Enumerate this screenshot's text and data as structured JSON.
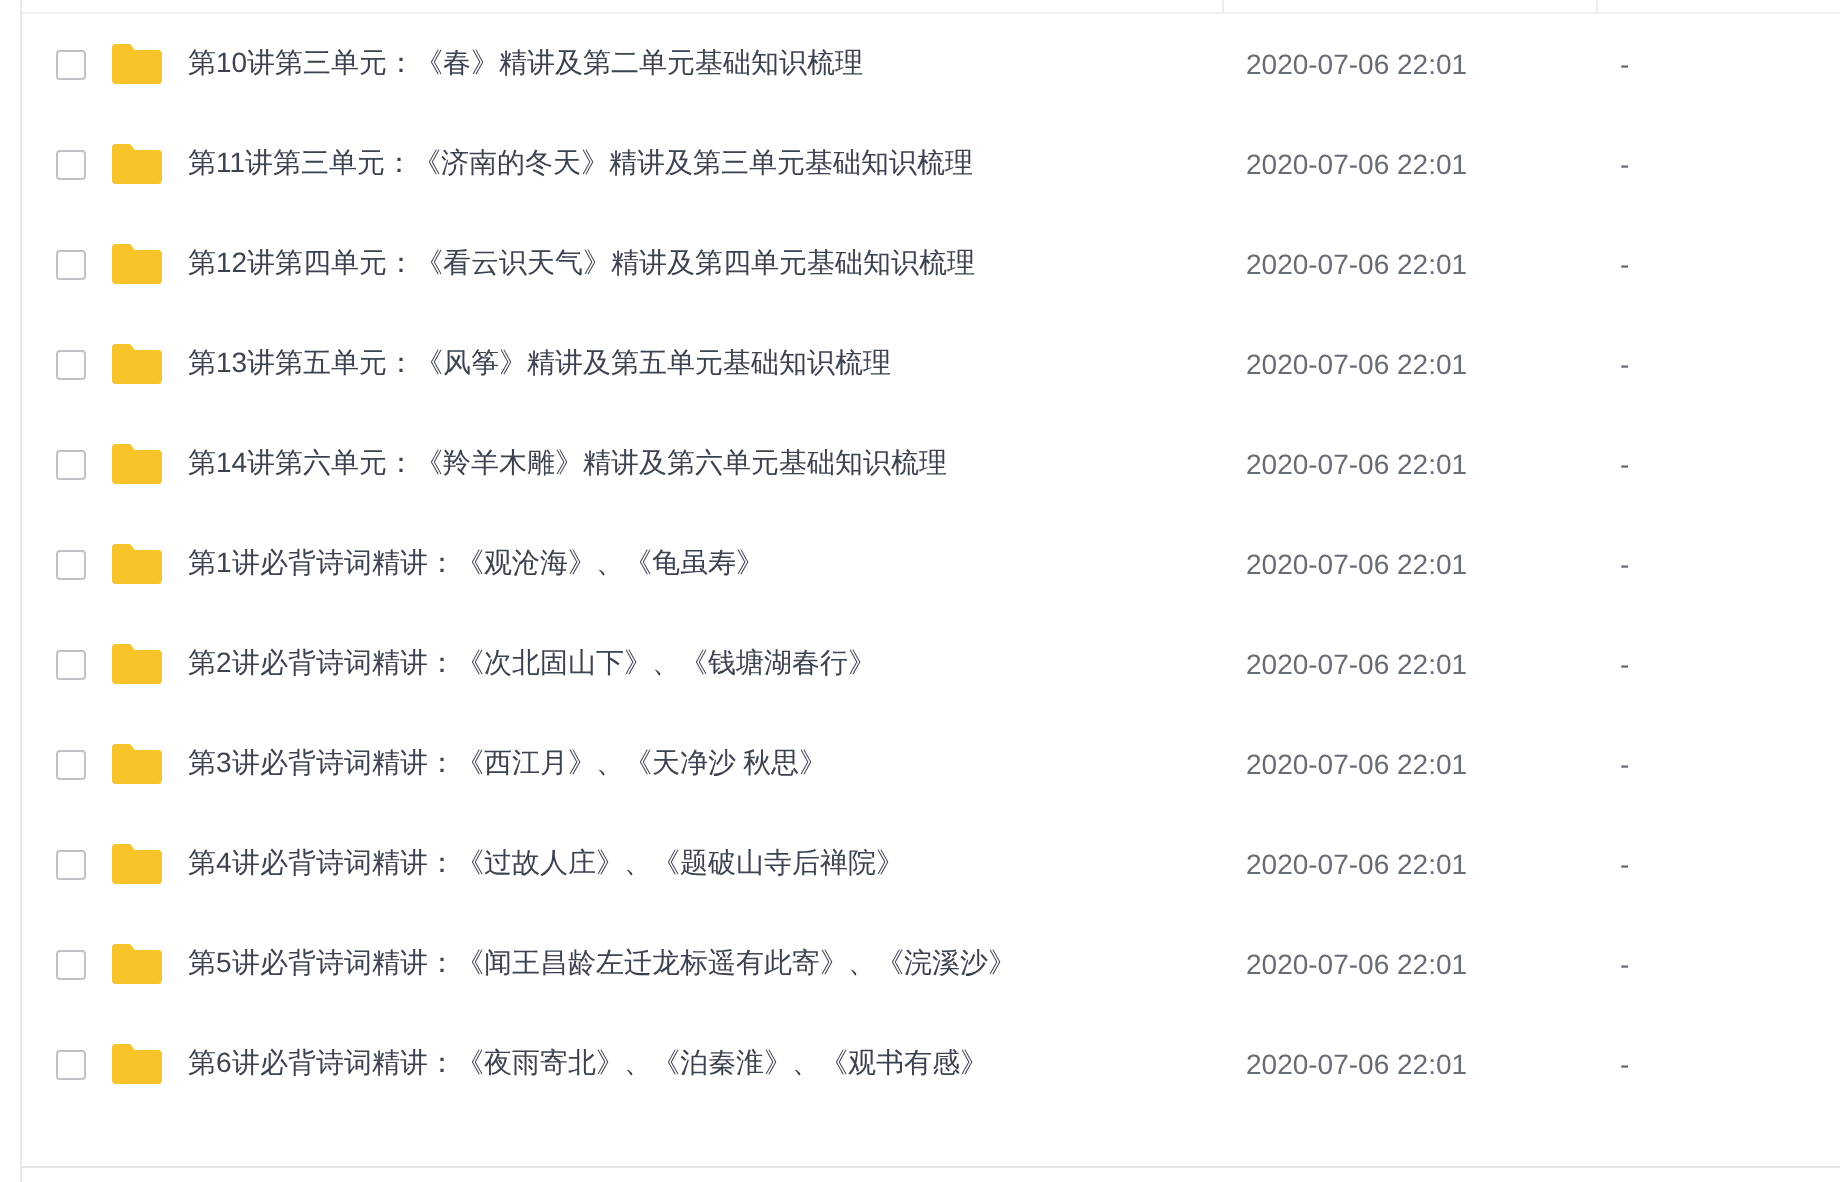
{
  "files": [
    {
      "name": "第10讲第三单元：《春》精讲及第二单元基础知识梳理",
      "modified": "2020-07-06 22:01",
      "size": "-",
      "checked": false
    },
    {
      "name": "第11讲第三单元：《济南的冬天》精讲及第三单元基础知识梳理",
      "modified": "2020-07-06 22:01",
      "size": "-",
      "checked": false
    },
    {
      "name": "第12讲第四单元：《看云识天气》精讲及第四单元基础知识梳理",
      "modified": "2020-07-06 22:01",
      "size": "-",
      "checked": false
    },
    {
      "name": "第13讲第五单元：《风筝》精讲及第五单元基础知识梳理",
      "modified": "2020-07-06 22:01",
      "size": "-",
      "checked": false
    },
    {
      "name": "第14讲第六单元：《羚羊木雕》精讲及第六单元基础知识梳理",
      "modified": "2020-07-06 22:01",
      "size": "-",
      "checked": false
    },
    {
      "name": "第1讲必背诗词精讲：《观沧海》、《龟虽寿》",
      "modified": "2020-07-06 22:01",
      "size": "-",
      "checked": false
    },
    {
      "name": "第2讲必背诗词精讲：《次北固山下》、《钱塘湖春行》",
      "modified": "2020-07-06 22:01",
      "size": "-",
      "checked": false
    },
    {
      "name": "第3讲必背诗词精讲：《西江月》、《天净沙 秋思》",
      "modified": "2020-07-06 22:01",
      "size": "-",
      "checked": false
    },
    {
      "name": "第4讲必背诗词精讲：《过故人庄》、《题破山寺后禅院》",
      "modified": "2020-07-06 22:01",
      "size": "-",
      "checked": false
    },
    {
      "name": "第5讲必背诗词精讲：《闻王昌龄左迁龙标遥有此寄》、《浣溪沙》",
      "modified": "2020-07-06 22:01",
      "size": "-",
      "checked": false
    },
    {
      "name": "第6讲必背诗词精讲：《夜雨寄北》、《泊秦淮》、《观书有感》",
      "modified": "2020-07-06 22:01",
      "size": "-",
      "checked": false
    }
  ]
}
